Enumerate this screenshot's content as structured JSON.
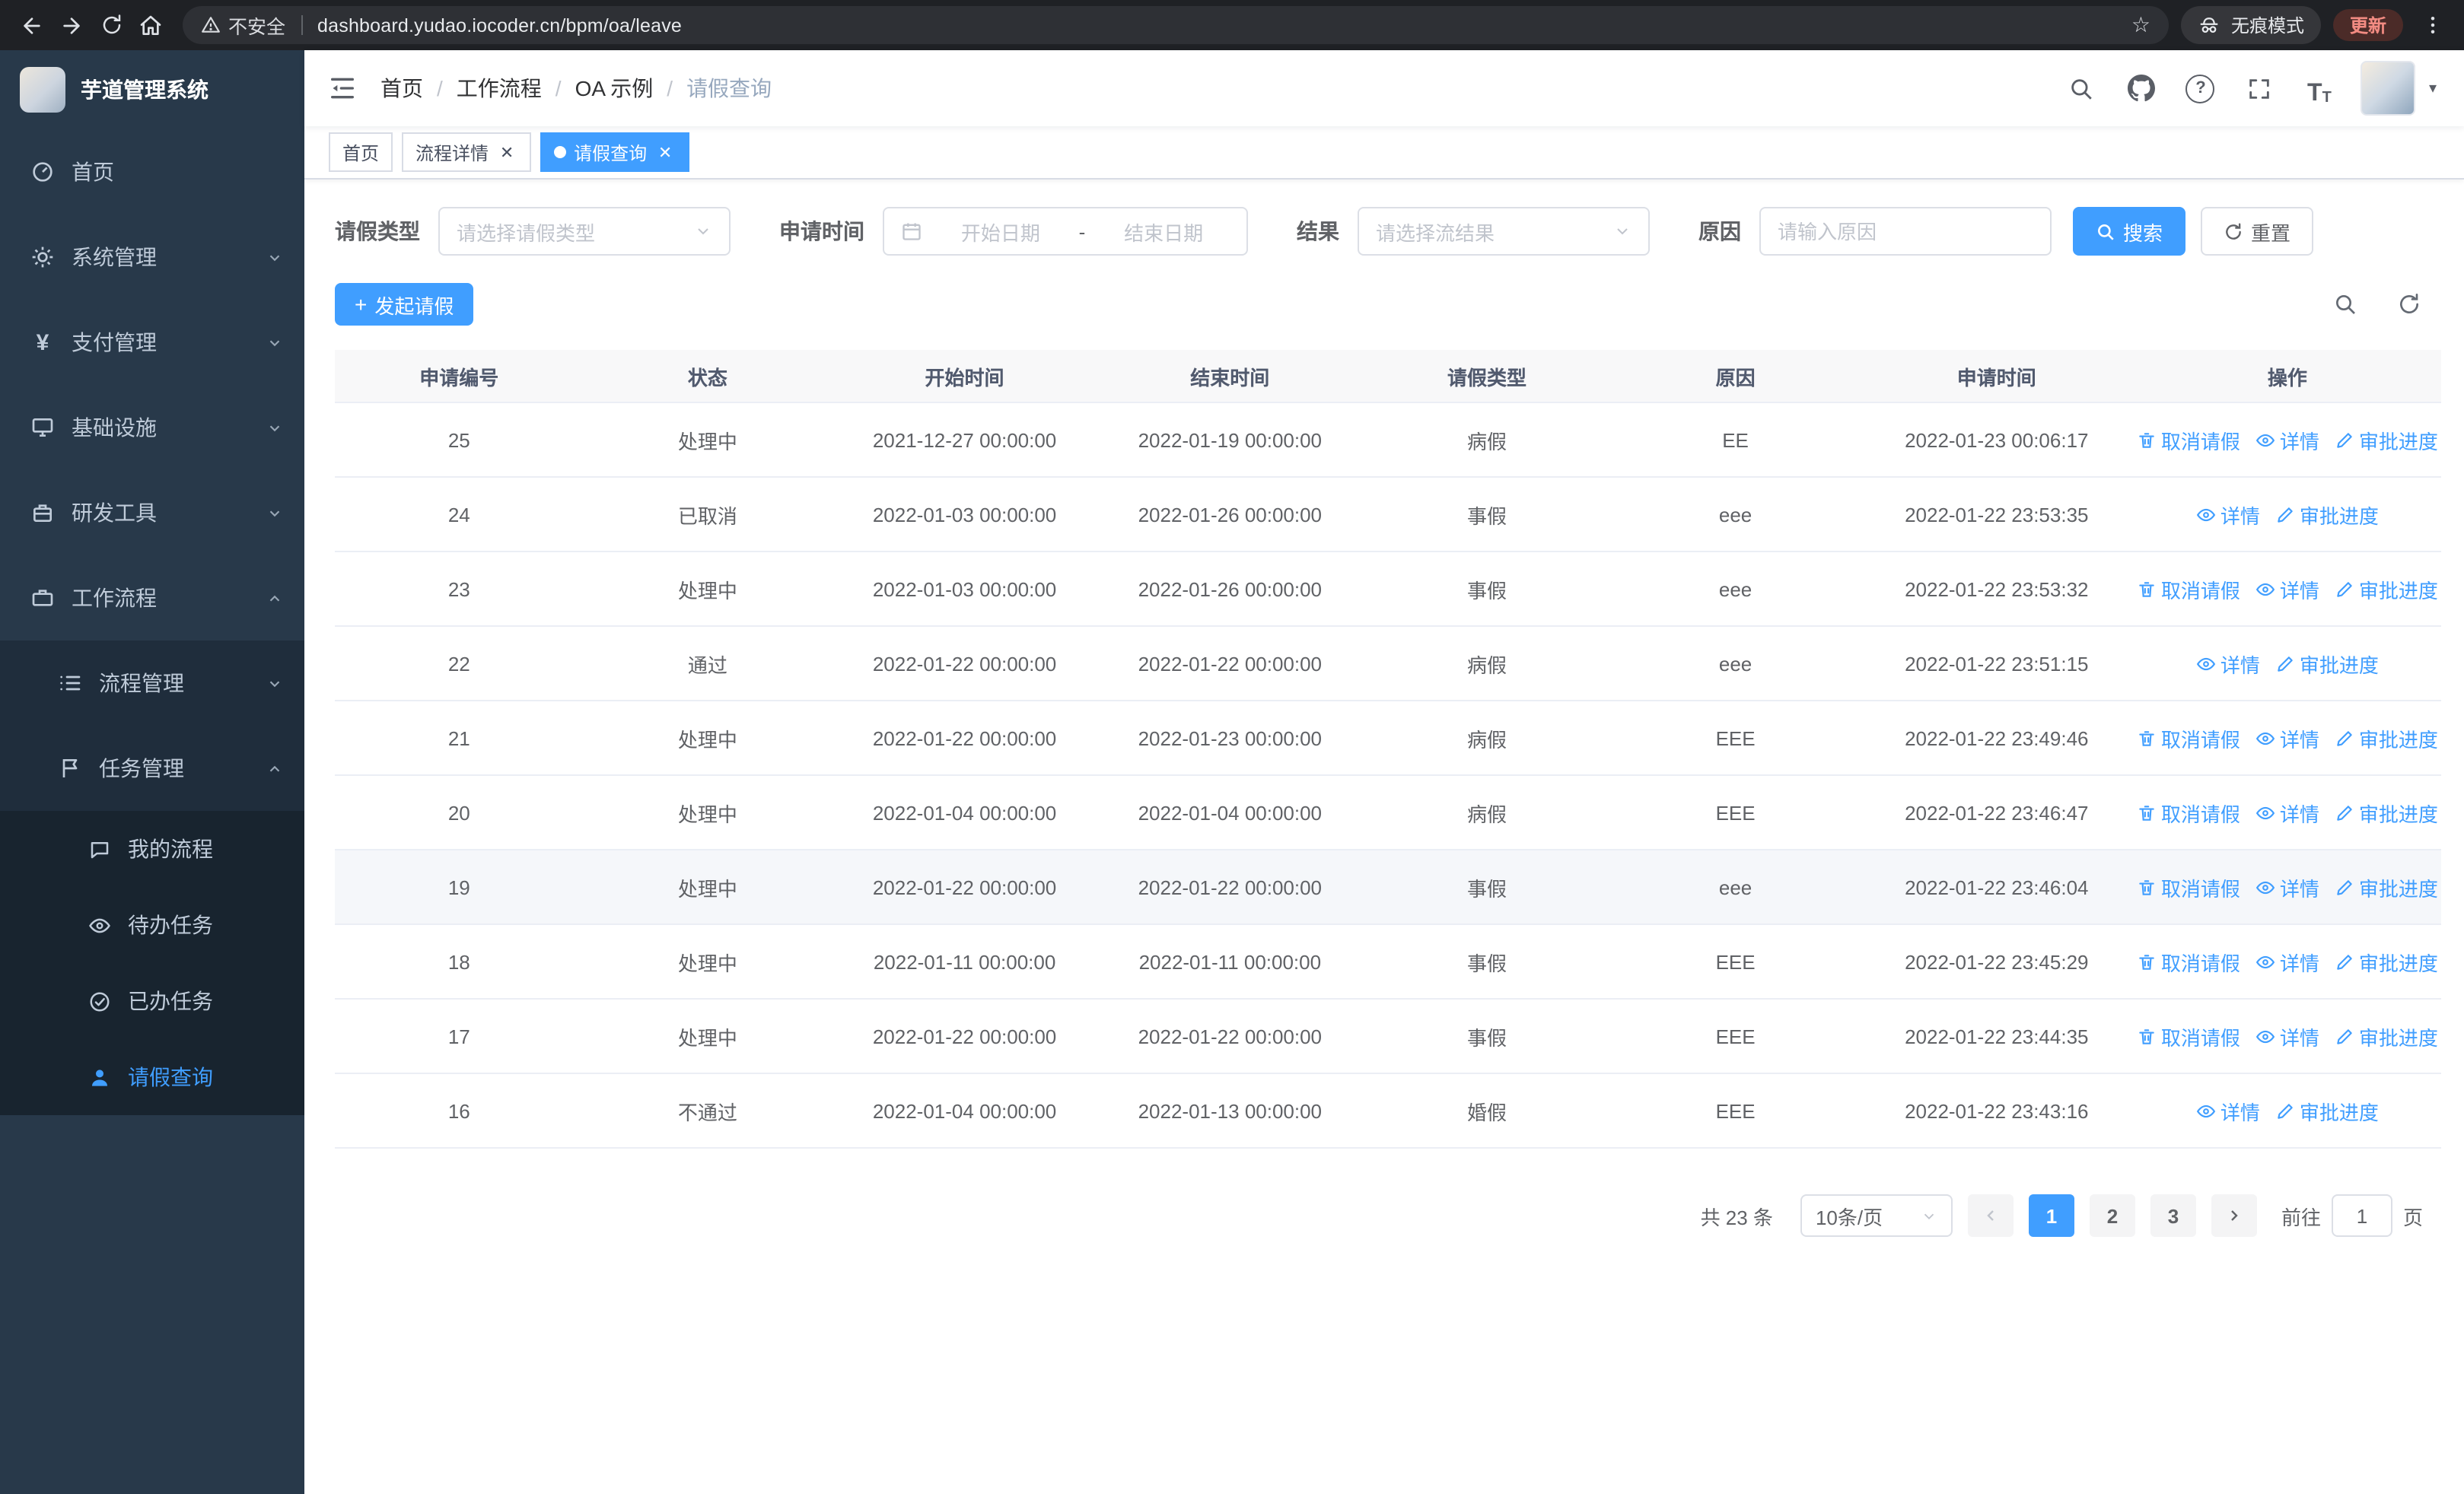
{
  "browser": {
    "security_label": "不安全",
    "url": "dashboard.yudao.iocoder.cn/bpm/oa/leave",
    "incognito_label": "无痕模式",
    "update_label": "更新"
  },
  "sidebar": {
    "app_title": "芋道管理系统",
    "items": [
      {
        "label": "首页"
      },
      {
        "label": "系统管理"
      },
      {
        "label": "支付管理"
      },
      {
        "label": "基础设施"
      },
      {
        "label": "研发工具"
      },
      {
        "label": "工作流程"
      },
      {
        "label": "流程管理"
      },
      {
        "label": "任务管理"
      },
      {
        "label": "我的流程"
      },
      {
        "label": "待办任务"
      },
      {
        "label": "已办任务"
      },
      {
        "label": "请假查询"
      }
    ]
  },
  "header": {
    "breadcrumb": [
      "首页",
      "工作流程",
      "OA 示例",
      "请假查询"
    ],
    "separator": "/"
  },
  "tabs": [
    {
      "label": "首页"
    },
    {
      "label": "流程详情"
    },
    {
      "label": "请假查询"
    }
  ],
  "filters": {
    "leave_type_label": "请假类型",
    "leave_type_placeholder": "请选择请假类型",
    "time_label": "申请时间",
    "start_placeholder": "开始日期",
    "range_separator": "-",
    "end_placeholder": "结束日期",
    "result_label": "结果",
    "result_placeholder": "请选择流结果",
    "reason_label": "原因",
    "reason_placeholder": "请输入原因",
    "search_label": "搜索",
    "reset_label": "重置"
  },
  "toolbar": {
    "create_label": "发起请假"
  },
  "table": {
    "columns": [
      "申请编号",
      "状态",
      "开始时间",
      "结束时间",
      "请假类型",
      "原因",
      "申请时间",
      "操作"
    ],
    "action_labels": {
      "cancel": "取消请假",
      "detail": "详情",
      "progress": "审批进度"
    },
    "rows": [
      {
        "id": "25",
        "status": "处理中",
        "start": "2021-12-27 00:00:00",
        "end": "2022-01-19 00:00:00",
        "type": "病假",
        "reason": "EE",
        "applied": "2022-01-23 00:06:17",
        "actions": [
          "cancel",
          "detail",
          "progress"
        ]
      },
      {
        "id": "24",
        "status": "已取消",
        "start": "2022-01-03 00:00:00",
        "end": "2022-01-26 00:00:00",
        "type": "事假",
        "reason": "eee",
        "applied": "2022-01-22 23:53:35",
        "actions": [
          "detail",
          "progress"
        ]
      },
      {
        "id": "23",
        "status": "处理中",
        "start": "2022-01-03 00:00:00",
        "end": "2022-01-26 00:00:00",
        "type": "事假",
        "reason": "eee",
        "applied": "2022-01-22 23:53:32",
        "actions": [
          "cancel",
          "detail",
          "progress"
        ]
      },
      {
        "id": "22",
        "status": "通过",
        "start": "2022-01-22 00:00:00",
        "end": "2022-01-22 00:00:00",
        "type": "病假",
        "reason": "eee",
        "applied": "2022-01-22 23:51:15",
        "actions": [
          "detail",
          "progress"
        ]
      },
      {
        "id": "21",
        "status": "处理中",
        "start": "2022-01-22 00:00:00",
        "end": "2022-01-23 00:00:00",
        "type": "病假",
        "reason": "EEE",
        "applied": "2022-01-22 23:49:46",
        "actions": [
          "cancel",
          "detail",
          "progress"
        ]
      },
      {
        "id": "20",
        "status": "处理中",
        "start": "2022-01-04 00:00:00",
        "end": "2022-01-04 00:00:00",
        "type": "病假",
        "reason": "EEE",
        "applied": "2022-01-22 23:46:47",
        "actions": [
          "cancel",
          "detail",
          "progress"
        ]
      },
      {
        "id": "19",
        "status": "处理中",
        "start": "2022-01-22 00:00:00",
        "end": "2022-01-22 00:00:00",
        "type": "事假",
        "reason": "eee",
        "applied": "2022-01-22 23:46:04",
        "actions": [
          "cancel",
          "detail",
          "progress"
        ],
        "highlight": true
      },
      {
        "id": "18",
        "status": "处理中",
        "start": "2022-01-11 00:00:00",
        "end": "2022-01-11 00:00:00",
        "type": "事假",
        "reason": "EEE",
        "applied": "2022-01-22 23:45:29",
        "actions": [
          "cancel",
          "detail",
          "progress"
        ]
      },
      {
        "id": "17",
        "status": "处理中",
        "start": "2022-01-22 00:00:00",
        "end": "2022-01-22 00:00:00",
        "type": "事假",
        "reason": "EEE",
        "applied": "2022-01-22 23:44:35",
        "actions": [
          "cancel",
          "detail",
          "progress"
        ]
      },
      {
        "id": "16",
        "status": "不通过",
        "start": "2022-01-04 00:00:00",
        "end": "2022-01-13 00:00:00",
        "type": "婚假",
        "reason": "EEE",
        "applied": "2022-01-22 23:43:16",
        "actions": [
          "detail",
          "progress"
        ]
      }
    ]
  },
  "pagination": {
    "total": "共 23 条",
    "page_size": "10条/页",
    "pages": [
      "1",
      "2",
      "3"
    ],
    "active_page": "1",
    "goto_label": "前往",
    "goto_value": "1",
    "page_unit": "页"
  },
  "colors": {
    "primary": "#409eff",
    "sidebar_bg": "#28394a"
  }
}
